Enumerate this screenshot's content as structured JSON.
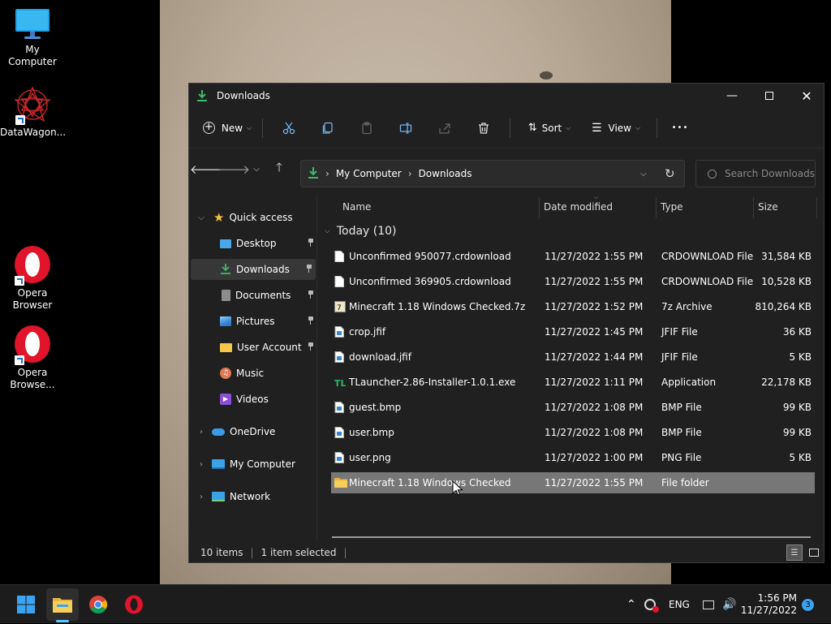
{
  "desktop": {
    "icons": [
      {
        "label": "My Computer"
      },
      {
        "label": "DataWagon..."
      },
      {
        "label": "Opera Browser"
      },
      {
        "label": "Opera Browse..."
      }
    ]
  },
  "window": {
    "title": "Downloads",
    "toolbar": {
      "new_label": "New",
      "sort_label": "Sort",
      "view_label": "View",
      "more_label": "•••"
    },
    "address": {
      "crumbs": [
        "My Computer",
        "Downloads"
      ],
      "search_placeholder": "Search Downloads"
    },
    "sidebar": {
      "items": [
        {
          "label": "Quick access"
        },
        {
          "label": "Desktop"
        },
        {
          "label": "Downloads"
        },
        {
          "label": "Documents"
        },
        {
          "label": "Pictures"
        },
        {
          "label": "User Account P"
        },
        {
          "label": "Music"
        },
        {
          "label": "Videos"
        },
        {
          "label": "OneDrive"
        },
        {
          "label": "My Computer"
        },
        {
          "label": "Network"
        }
      ]
    },
    "columns": {
      "name": "Name",
      "date": "Date modified",
      "type": "Type",
      "size": "Size"
    },
    "group_label": "Today (10)",
    "files": [
      {
        "name": "Unconfirmed 950077.crdownload",
        "date": "11/27/2022 1:55 PM",
        "type": "CRDOWNLOAD File",
        "size": "31,584 KB",
        "icon": "blank-file-icon"
      },
      {
        "name": "Unconfirmed 369905.crdownload",
        "date": "11/27/2022 1:55 PM",
        "type": "CRDOWNLOAD File",
        "size": "10,528 KB",
        "icon": "blank-file-icon"
      },
      {
        "name": "Minecraft 1.18 Windows Checked.7z",
        "date": "11/27/2022 1:52 PM",
        "type": "7z Archive",
        "size": "810,264 KB",
        "icon": "archive-icon"
      },
      {
        "name": "crop.jfif",
        "date": "11/27/2022 1:45 PM",
        "type": "JFIF File",
        "size": "36 KB",
        "icon": "image-file-icon"
      },
      {
        "name": "download.jfif",
        "date": "11/27/2022 1:44 PM",
        "type": "JFIF File",
        "size": "5 KB",
        "icon": "image-file-icon"
      },
      {
        "name": "TLauncher-2.86-Installer-1.0.1.exe",
        "date": "11/27/2022 1:11 PM",
        "type": "Application",
        "size": "22,178 KB",
        "icon": "app-icon"
      },
      {
        "name": "guest.bmp",
        "date": "11/27/2022 1:08 PM",
        "type": "BMP File",
        "size": "99 KB",
        "icon": "image-file-icon"
      },
      {
        "name": "user.bmp",
        "date": "11/27/2022 1:08 PM",
        "type": "BMP File",
        "size": "99 KB",
        "icon": "image-file-icon"
      },
      {
        "name": "user.png",
        "date": "11/27/2022 1:00 PM",
        "type": "PNG File",
        "size": "5 KB",
        "icon": "image-file-icon"
      },
      {
        "name": "Minecraft 1.18 Windows Checked",
        "date": "11/27/2022 1:55 PM",
        "type": "File folder",
        "size": "",
        "icon": "folder-icon",
        "selected": true
      }
    ],
    "status": {
      "items": "10 items",
      "selected": "1 item selected"
    }
  },
  "taskbar": {
    "tray": {
      "language": "ENG",
      "time": "1:56 PM",
      "date": "11/27/2022",
      "notifications": "3"
    }
  },
  "colors": {
    "accent": "#0078d4",
    "folder": "#f4c64a",
    "download_green": "#3fb96b",
    "opera_red": "#e0142b"
  }
}
